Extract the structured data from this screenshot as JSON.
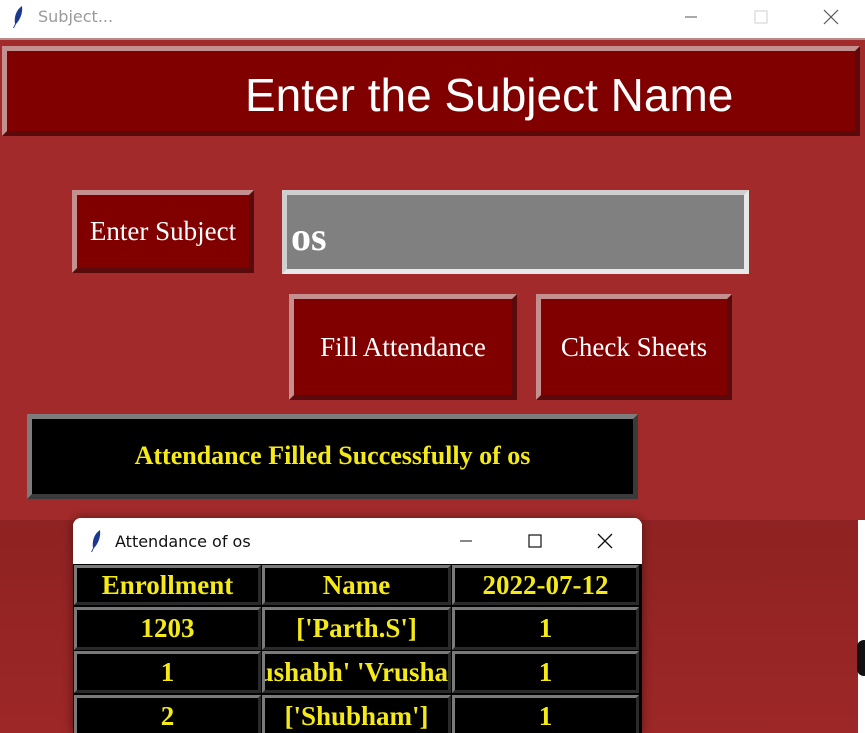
{
  "main_window": {
    "title": "Subject...",
    "header_text": "Enter the Subject Name",
    "enter_subject_label": "Enter Subject",
    "subject_value": "os",
    "fill_attendance_label": "Fill Attendance",
    "check_sheets_label": "Check Sheets",
    "status_message": "Attendance Filled Successfully of os"
  },
  "attendance_window": {
    "title": "Attendance of os",
    "columns": [
      "Enrollment",
      "Name",
      "2022-07-12"
    ],
    "rows": [
      [
        "1203",
        "['Parth.S']",
        "1"
      ],
      [
        "1",
        "'Rushabh' 'Vrusha",
        "1"
      ],
      [
        "2",
        "['Shubham']",
        "1"
      ]
    ]
  },
  "colors": {
    "window_background": "#a32a2a",
    "button_background": "#800000",
    "status_text": "#f5ea18",
    "input_background": "#808080"
  },
  "icons": [
    "feather-icon",
    "minimize-icon",
    "maximize-icon",
    "close-icon"
  ]
}
